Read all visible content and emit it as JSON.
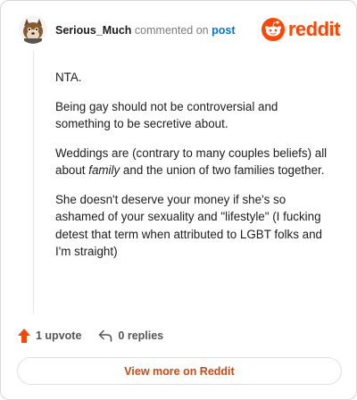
{
  "header": {
    "username": "Serious_Much",
    "commented_on": "commented on",
    "post_link": "post",
    "brand": "reddit"
  },
  "comment": {
    "paragraphs": [
      {
        "text": "NTA."
      },
      {
        "text": "Being gay should not be controversial and something to be secretive about."
      },
      {
        "before": "Weddings are (contrary to many couples beliefs) all about ",
        "emphasis": "family",
        "after": " and the union of two families together."
      },
      {
        "text": "She doesn't deserve your money if she's so ashamed of your sexuality and \"lifestyle\" (I fucking detest that term when attributed to LGBT folks and I'm straight)"
      }
    ]
  },
  "actions": {
    "upvotes": "1 upvote",
    "replies": "0 replies"
  },
  "footer": {
    "view_more": "View more on Reddit"
  },
  "colors": {
    "brand": "#ff4500",
    "link": "#0079d3",
    "view_more": "#c94a11"
  },
  "icons": {
    "avatar": "avatar-icon",
    "logo": "snoo-icon",
    "upvote": "upvote-arrow-icon",
    "reply": "reply-arrow-icon"
  }
}
